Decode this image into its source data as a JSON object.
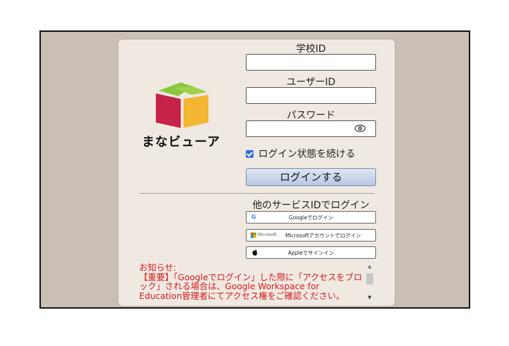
{
  "app": {
    "brand_name": "まなビューア"
  },
  "login": {
    "school_id_label": "学校ID",
    "school_id_value": "",
    "user_id_label": "ユーザーID",
    "user_id_value": "",
    "password_label": "パスワード",
    "password_value": "",
    "keep_logged_in_label": "ログイン状態を続ける",
    "keep_logged_in_checked": true,
    "login_button": "ログインする"
  },
  "sso": {
    "heading": "他のサービスIDでログイン",
    "google": {
      "icon": "google-g-icon",
      "label": "Googleでログイン"
    },
    "microsoft": {
      "icon": "microsoft-logo-icon",
      "brand": "Microsoft",
      "label": "Microsoftアカウントでログイン"
    },
    "apple": {
      "icon": "apple-logo-icon",
      "label": "Appleでサインイン"
    }
  },
  "notice": {
    "title": "お知らせ:",
    "body": "【重要】「Googleでログイン」した際に「アクセスをブロック」される場合は、Google Workspace for Education管理者にてアクセス権をご確認ください。"
  },
  "colors": {
    "backdrop": "#c9bfb5",
    "panel": "#efe9e2",
    "notice_text": "#d21b1b",
    "button_gradient_top": "#dfe6f3",
    "button_gradient_bottom": "#b9c7e2",
    "logo_green": "#8cc63f",
    "logo_red": "#c7234a",
    "logo_yellow": "#f2b632"
  }
}
